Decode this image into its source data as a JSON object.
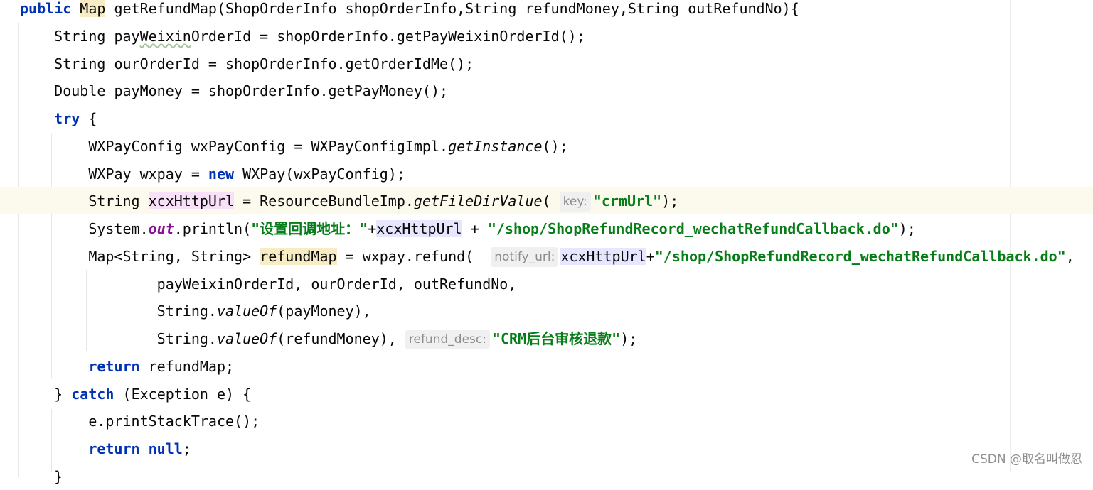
{
  "editor": {
    "lines": [
      {
        "indent": "",
        "tokens": [
          {
            "t": "public",
            "c": "kw"
          },
          {
            "t": " "
          },
          {
            "t": "Map",
            "c": "hl-y"
          },
          {
            "t": " getRefundMap(ShopOrderInfo shopOrderInfo,String refundMoney,String outRefundNo){"
          }
        ]
      },
      {
        "indent": "    ",
        "tokens": [
          {
            "t": "String pay"
          },
          {
            "t": "Weixin",
            "c": "warn"
          },
          {
            "t": "OrderId = shopOrderInfo.getPayWeixinOrderId();"
          }
        ]
      },
      {
        "indent": "    ",
        "tokens": [
          {
            "t": "String ourOrderId = shopOrderInfo.getOrderIdMe();"
          }
        ]
      },
      {
        "indent": "    ",
        "tokens": [
          {
            "t": "Double payMoney = shopOrderInfo.getPayMoney();"
          }
        ]
      },
      {
        "indent": "    ",
        "tokens": [
          {
            "t": "try",
            "c": "kw"
          },
          {
            "t": " {"
          }
        ]
      },
      {
        "indent": "        ",
        "tokens": [
          {
            "t": "WXPayConfig wxPayConfig = WXPayConfigImpl."
          },
          {
            "t": "getInstance",
            "c": "ital"
          },
          {
            "t": "();"
          }
        ]
      },
      {
        "indent": "        ",
        "tokens": [
          {
            "t": "WXPay wxpay = "
          },
          {
            "t": "new",
            "c": "kw"
          },
          {
            "t": " WXPay(wxPayConfig);"
          }
        ]
      },
      {
        "indent": "        ",
        "current": true,
        "tokens": [
          {
            "t": "String "
          },
          {
            "t": "xcxHttpUrl",
            "c": "hl-p"
          },
          {
            "t": " = ResourceBundleImp."
          },
          {
            "t": "getFileDirValue",
            "c": "ital"
          },
          {
            "t": "( "
          },
          {
            "t": "key:",
            "c": "hint"
          },
          {
            "t": "\"crmUrl\"",
            "c": "str"
          },
          {
            "t": ");"
          }
        ]
      },
      {
        "indent": "        ",
        "tokens": [
          {
            "t": "System."
          },
          {
            "t": "out",
            "c": "fld"
          },
          {
            "t": ".println("
          },
          {
            "t": "\"设置回调地址：\"",
            "c": "str"
          },
          {
            "t": "+"
          },
          {
            "t": "xcxHttpUrl",
            "c": "hl-b"
          },
          {
            "t": " + "
          },
          {
            "t": "\"/shop/ShopRefundRecord_wechatRefundCallback.do\"",
            "c": "str"
          },
          {
            "t": ");"
          }
        ]
      },
      {
        "indent": "        ",
        "tokens": [
          {
            "t": "Map<String, String> "
          },
          {
            "t": "refundMap",
            "c": "hl-y"
          },
          {
            "t": " = wxpay.refund(  "
          },
          {
            "t": "notify_url:",
            "c": "hint"
          },
          {
            "t": "xcxHttpUrl",
            "c": "hl-b"
          },
          {
            "t": "+"
          },
          {
            "t": "\"/shop/ShopRefundRecord_wechatRefundCallback.do\"",
            "c": "str"
          },
          {
            "t": ","
          }
        ]
      },
      {
        "indent": "                ",
        "tokens": [
          {
            "t": "payWeixinOrderId, ourOrderId, outRefundNo,"
          }
        ]
      },
      {
        "indent": "                ",
        "tokens": [
          {
            "t": "String."
          },
          {
            "t": "valueOf",
            "c": "ital"
          },
          {
            "t": "(payMoney),"
          }
        ]
      },
      {
        "indent": "                ",
        "tokens": [
          {
            "t": "String."
          },
          {
            "t": "valueOf",
            "c": "ital"
          },
          {
            "t": "(refundMoney), "
          },
          {
            "t": "refund_desc:",
            "c": "hint"
          },
          {
            "t": "\"CRM后台审核退款\"",
            "c": "str"
          },
          {
            "t": ");"
          }
        ]
      },
      {
        "indent": "        ",
        "tokens": [
          {
            "t": "return",
            "c": "kw"
          },
          {
            "t": " refundMap;"
          }
        ]
      },
      {
        "indent": "    ",
        "tokens": [
          {
            "t": "} "
          },
          {
            "t": "catch",
            "c": "kw"
          },
          {
            "t": " (Exception e) {"
          }
        ]
      },
      {
        "indent": "        ",
        "tokens": [
          {
            "t": "e.printStackTrace();"
          }
        ]
      },
      {
        "indent": "        ",
        "tokens": [
          {
            "t": "return",
            "c": "kw"
          },
          {
            "t": " "
          },
          {
            "t": "null",
            "c": "kw"
          },
          {
            "t": ";"
          }
        ]
      },
      {
        "indent": "    ",
        "tokens": [
          {
            "t": "}"
          }
        ]
      }
    ]
  },
  "watermark": {
    "text": "CSDN @取名叫做忍"
  }
}
